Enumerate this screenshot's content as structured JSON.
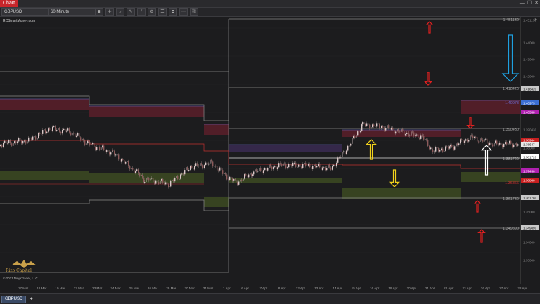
{
  "titlebar": {
    "app_tab": "Chart"
  },
  "toolbar": {
    "instrument": "GBPUSD",
    "interval": "60 Minute"
  },
  "chart": {
    "title": "RCSmartMoney.com",
    "copyright": "© 2021 NinjaTrader, LLC",
    "logo_text": "Rizo Capital",
    "f_label": "F",
    "price_labels": [
      {
        "text": "1.451130",
        "style": "plain"
      },
      {
        "text": "1.44000",
        "style": "plain"
      },
      {
        "text": "1.43000",
        "style": "plain"
      },
      {
        "text": "1.42000",
        "style": "plain"
      },
      {
        "text": "1.418420",
        "style": "box-gray"
      },
      {
        "text": "1.40973",
        "style": "box-blue"
      },
      {
        "text": "1.40538",
        "style": "box-magenta"
      },
      {
        "text": "1.390430",
        "style": "plain"
      },
      {
        "text": "1.38964",
        "style": "box-red"
      },
      {
        "text": "1.38647",
        "style": "box-white"
      },
      {
        "text": "1.38000",
        "style": "plain"
      },
      {
        "text": "1.381720",
        "style": "box-white2"
      },
      {
        "text": "1.37436",
        "style": "box-magenta"
      },
      {
        "text": "1.36866",
        "style": "box-red"
      },
      {
        "text": "1.361780",
        "style": "box-gray"
      },
      {
        "text": "1.35000",
        "style": "plain"
      },
      {
        "text": "1.349890",
        "style": "box-gray"
      },
      {
        "text": "1.34000",
        "style": "plain"
      },
      {
        "text": "1.33000",
        "style": "plain"
      }
    ],
    "in_chart_labels": [
      "1.451130",
      "1.418420",
      "1.390430",
      "1.381720",
      "1.361780",
      "1.349890"
    ],
    "in_chart_red_label": "1.36866",
    "in_chart_blue_label": "1.40973",
    "dates": [
      "17 Mar",
      "18 Mar",
      "19 Mar",
      "22 Mar",
      "23 Mar",
      "24 Mar",
      "25 Mar",
      "26 Mar",
      "29 Mar",
      "30 Mar",
      "31 Mar",
      "1 Apr",
      "6 Apr",
      "7 Apr",
      "8 Apr",
      "12 Apr",
      "13 Apr",
      "14 Apr",
      "15 Apr",
      "16 Apr",
      "19 Apr",
      "20 Apr",
      "21 Apr",
      "22 Apr",
      "23 Apr",
      "26 Apr",
      "27 Apr",
      "28 Apr"
    ],
    "colors": {
      "zone_red": "#5a1f2a",
      "zone_green": "#3c4a22",
      "candle": "#d9c7c7",
      "arrow_red": "#e02020",
      "arrow_yellow": "#f2d21b",
      "arrow_blue": "#1ea0e0",
      "arrow_white": "#ffffff"
    }
  },
  "tabbar": {
    "instrument_tab": "GBPUSD",
    "add_tab": "+"
  }
}
